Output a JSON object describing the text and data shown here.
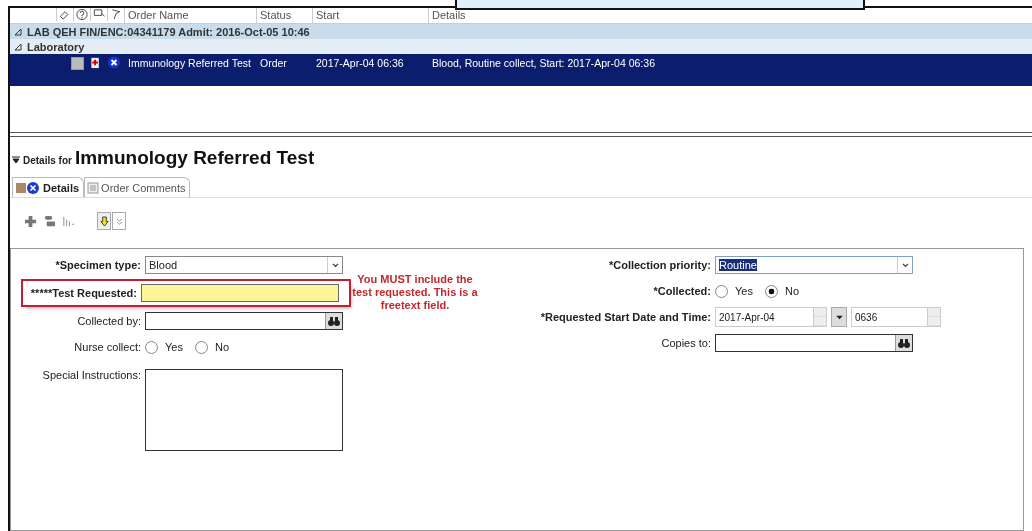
{
  "order_list": {
    "columns": [
      "Order Name",
      "Status",
      "Start",
      "Details"
    ],
    "groups": [
      {
        "label": "LAB QEH  FIN/ENC:04341179  Admit: 2016-Oct-05 10:46",
        "expanded": true
      },
      {
        "label": "Laboratory",
        "expanded": true
      }
    ],
    "rows": [
      {
        "name": "Immunology Referred Test",
        "status": "Order",
        "start": "2017-Apr-04 06:36",
        "details": "Blood, Routine collect, Start: 2017-Apr-04 06:36",
        "selected": true,
        "checked": false
      }
    ]
  },
  "details": {
    "prefix": "Details for",
    "title": "Immunology Referred Test",
    "tabs": [
      {
        "label": "Details",
        "selected": true
      },
      {
        "label": "Order Comments",
        "selected": false
      }
    ]
  },
  "form": {
    "left": [
      {
        "kind": "dropdown",
        "label": "*Specimen type:",
        "value": "Blood",
        "bold": true
      },
      {
        "kind": "text",
        "label": "*****Test Requested:",
        "bold": true,
        "highlighted": true
      },
      {
        "kind": "lookup",
        "label": "Collected by:",
        "bold": false
      },
      {
        "kind": "radio",
        "label": "Nurse collect:",
        "bold": false,
        "options": [
          {
            "label": "Yes",
            "selected": false
          },
          {
            "label": "No",
            "selected": false
          }
        ]
      },
      {
        "kind": "textarea",
        "label": "Special Instructions:",
        "bold": false
      }
    ],
    "note": "You MUST include the test requested.  This is a freetext field.",
    "right": [
      {
        "kind": "dropdown",
        "label": "*Collection priority:",
        "value": "Routine",
        "bold": true
      },
      {
        "kind": "radio",
        "label": "*Collected:",
        "bold": true,
        "options": [
          {
            "label": "Yes",
            "selected": false
          },
          {
            "label": "No",
            "selected": true
          }
        ]
      },
      {
        "kind": "datetime",
        "label": "*Requested Start Date and Time:",
        "value": "2017-Apr-04",
        "time": "0636",
        "bold": true
      },
      {
        "kind": "lookup",
        "label": "Copies to:",
        "bold": false
      }
    ]
  }
}
